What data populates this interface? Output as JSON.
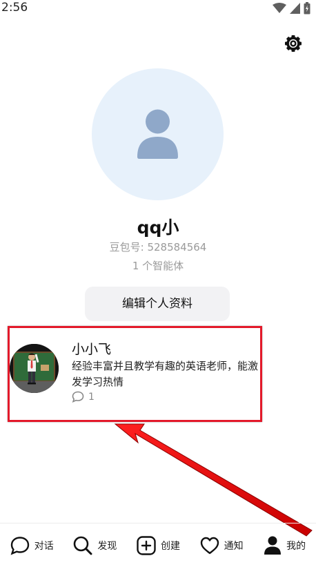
{
  "status_bar": {
    "time": "2:56",
    "icons": [
      "wifi-icon",
      "signal-icon",
      "battery-icon"
    ]
  },
  "header": {
    "settings_icon": "gear-icon"
  },
  "profile": {
    "avatar_icon": "person-icon",
    "name": "qq小",
    "id_text": "豆包号: 528584564",
    "agent_count": "1 个智能体",
    "edit_button": "编辑个人资料"
  },
  "bot": {
    "name": "小小飞",
    "description": "经验丰富并且教学有趣的英语老师，能激发学习热情",
    "comment_count": "1"
  },
  "tabs": [
    {
      "label": "对话",
      "icon": "chat-icon"
    },
    {
      "label": "发现",
      "icon": "search-icon"
    },
    {
      "label": "创建",
      "icon": "add-icon"
    },
    {
      "label": "通知",
      "icon": "heart-icon"
    },
    {
      "label": "我的",
      "icon": "profile-icon"
    }
  ],
  "colors": {
    "highlight": "#e3192a",
    "avatar_bg": "#e7f1fb",
    "avatar_figure": "#8fa8c9"
  }
}
